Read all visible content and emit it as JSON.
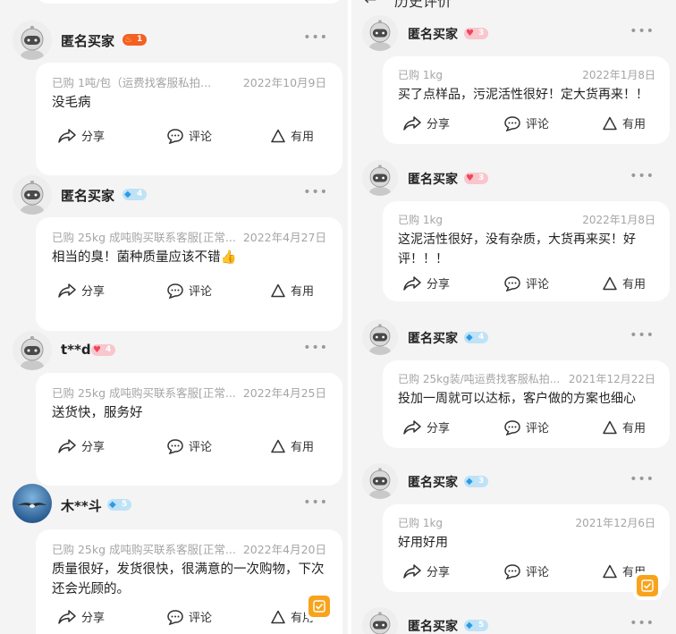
{
  "header": {
    "back_icon": "arrow-left-icon",
    "title": "历史评价",
    "more_icon": "more-dots-icon"
  },
  "actions": {
    "share": "分享",
    "comment": "评论",
    "useful": "有用"
  },
  "more_glyph": "•••",
  "left_reviews": [
    {
      "user": "匿名买家",
      "avatar": "astronaut-avatar",
      "badge": {
        "type": "fire",
        "level": "1"
      },
      "purchase": "已购 1吨/包（运费找客服私拍...",
      "date": "2022年10月9日",
      "text": "没毛病"
    },
    {
      "user": "匿名买家",
      "avatar": "astronaut-avatar",
      "badge": {
        "type": "diamond",
        "level": "4"
      },
      "purchase": "已购 25kg 成吨购买联系客服[正常...",
      "date": "2022年4月27日",
      "text": "相当的臭！菌种质量应该不错👍"
    },
    {
      "user": "t**d",
      "avatar": "astronaut-avatar",
      "badge": {
        "type": "heart",
        "level": "4"
      },
      "purchase": "已购 25kg 成吨购买联系客服[正常...",
      "date": "2022年4月25日",
      "text": "送货快，服务好"
    },
    {
      "user": "木**斗",
      "avatar": "bird-photo-avatar",
      "badge": {
        "type": "diamond",
        "level": "5"
      },
      "purchase": "已购 25kg 成吨购买联系客服[正常...",
      "date": "2022年4月20日",
      "text": "质量很好，发货很快，很满意的一次购物，下次还会光顾的。"
    }
  ],
  "right_reviews": [
    {
      "user": "匿名买家",
      "avatar": "astronaut-avatar",
      "badge": {
        "type": "heart",
        "level": "3"
      },
      "purchase": "已购 1kg",
      "date": "2022年1月8日",
      "text": "买了点样品，污泥活性很好！定大货再来！！"
    },
    {
      "user": "匿名买家",
      "avatar": "astronaut-avatar",
      "badge": {
        "type": "heart",
        "level": "3"
      },
      "purchase": "已购 1kg",
      "date": "2022年1月8日",
      "text": "这泥活性很好，没有杂质，大货再来买！好评！！！"
    },
    {
      "user": "匿名买家",
      "avatar": "astronaut-avatar",
      "badge": {
        "type": "diamond",
        "level": "4"
      },
      "purchase": "已购 25kg装/吨运费找客服私拍...",
      "date": "2021年12月22日",
      "text": "投加一周就可以达标，客户做的方案也细心"
    },
    {
      "user": "匿名买家",
      "avatar": "astronaut-avatar",
      "badge": {
        "type": "diamond",
        "level": "3"
      },
      "purchase": "已购 1kg",
      "date": "2021年12月6日",
      "text": "好用好用"
    },
    {
      "user": "匿名买家",
      "avatar": "astronaut-avatar",
      "badge": {
        "type": "diamond",
        "level": "5"
      }
    }
  ],
  "floating_button_icon": "checkmark-icon",
  "colors": {
    "accent_orange": "#f7a41c",
    "page_bg": "#f4f4f4",
    "card_bg": "#ffffff",
    "muted_text": "#a5a5a5",
    "diamond_badge": "#bfe2f7",
    "heart_badge": "#f8c6cc",
    "fire_badge": "#f46024"
  }
}
